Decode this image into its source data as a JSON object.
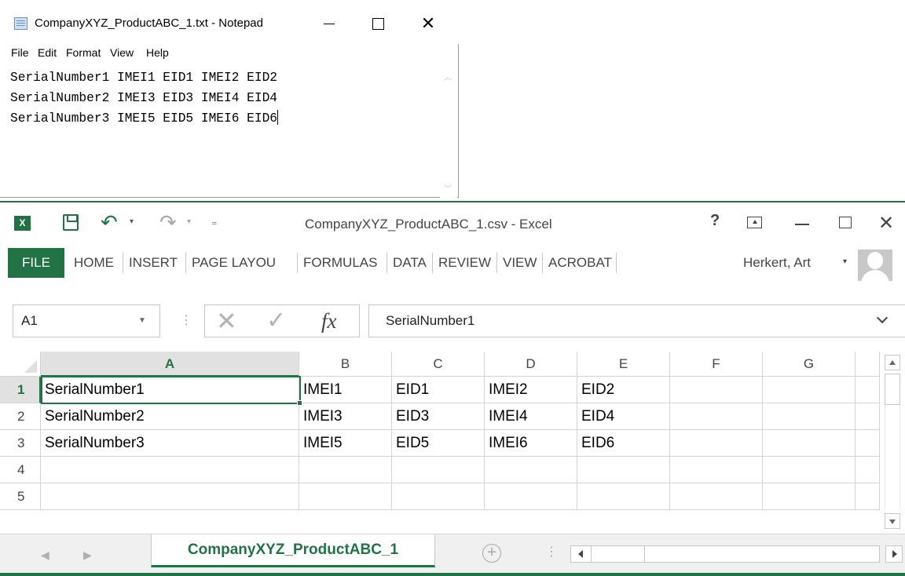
{
  "notepad": {
    "title": "CompanyXYZ_ProductABC_1.txt - Notepad",
    "menu": [
      "File",
      "Edit",
      "Format",
      "View",
      "Help"
    ],
    "lines": [
      "SerialNumber1 IMEI1 EID1 IMEI2 EID2",
      "SerialNumber2 IMEI3 EID3 IMEI4 EID4",
      "SerialNumber3 IMEI5 EID5 IMEI6 EID6"
    ],
    "icons": [
      "notepad-icon",
      "minimize-icon",
      "maximize-icon",
      "close-icon"
    ]
  },
  "excel": {
    "title": "CompanyXYZ_ProductABC_1.csv - Excel",
    "logo_text": "X",
    "help_label": "?",
    "tabs": {
      "file": "FILE",
      "items": [
        "HOME",
        "INSERT",
        "PAGE LAYOU",
        "FORMULAS",
        "DATA",
        "REVIEW",
        "VIEW",
        "ACROBAT"
      ]
    },
    "user": "Herkert, Art",
    "formula_bar": {
      "name_box": "A1",
      "fx_label": "fx",
      "value": "SerialNumber1"
    },
    "grid": {
      "columns": [
        "A",
        "B",
        "C",
        "D",
        "E",
        "F",
        "G"
      ],
      "selected_column": "A",
      "rows": [
        {
          "label": "1",
          "cells": [
            "SerialNumber1",
            "IMEI1",
            "EID1",
            "IMEI2",
            "EID2",
            "",
            ""
          ]
        },
        {
          "label": "2",
          "cells": [
            "SerialNumber2",
            "IMEI3",
            "EID3",
            "IMEI4",
            "EID4",
            "",
            ""
          ]
        },
        {
          "label": "3",
          "cells": [
            "SerialNumber3",
            "IMEI5",
            "EID5",
            "IMEI6",
            "EID6",
            "",
            ""
          ]
        },
        {
          "label": "4",
          "cells": [
            "",
            "",
            "",
            "",
            "",
            "",
            ""
          ]
        },
        {
          "label": "5",
          "cells": [
            "",
            "",
            "",
            "",
            "",
            "",
            ""
          ]
        }
      ],
      "active_cell": "A1"
    },
    "sheet_tab": "CompanyXYZ_ProductABC_1",
    "accent_color": "#217346"
  }
}
